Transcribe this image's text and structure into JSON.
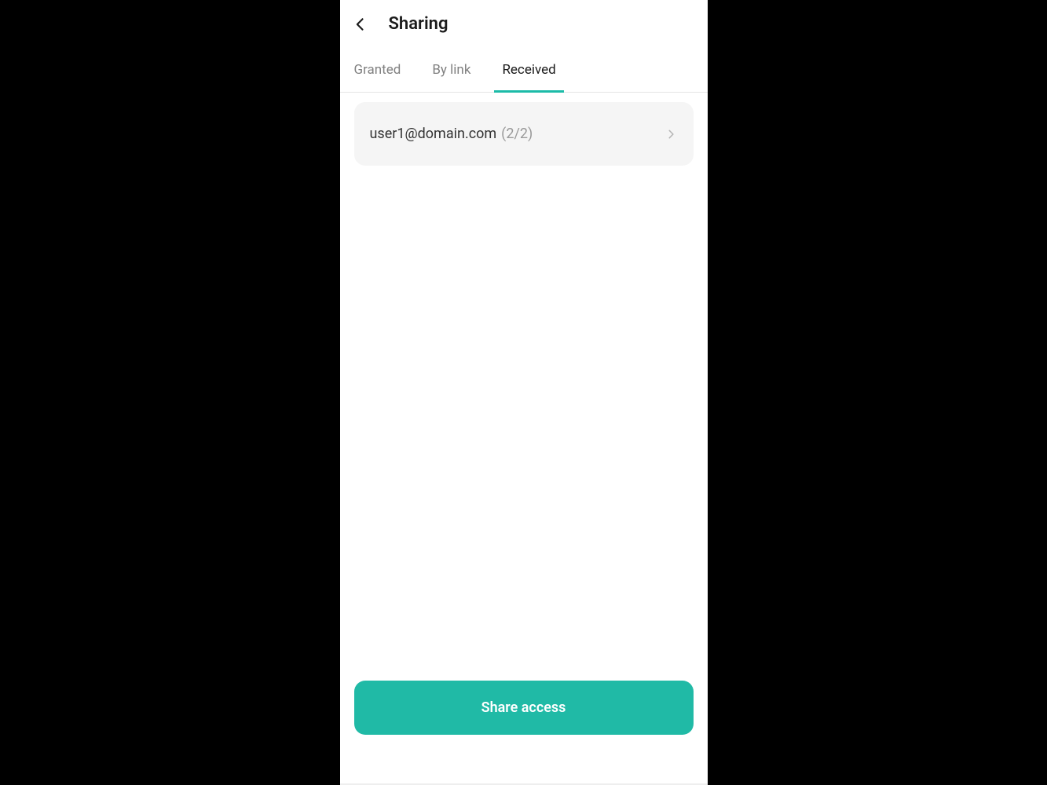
{
  "header": {
    "title": "Sharing"
  },
  "tabs": [
    {
      "label": "Granted",
      "active": false
    },
    {
      "label": "By link",
      "active": false
    },
    {
      "label": "Received",
      "active": true
    }
  ],
  "items": [
    {
      "email": "user1@domain.com",
      "count": "(2/2)"
    }
  ],
  "footer": {
    "share_label": "Share access"
  },
  "colors": {
    "accent": "#20baa6",
    "tab_underline": "#1cbba8",
    "card_bg": "#f5f5f5",
    "muted_text": "#9a9a9a"
  }
}
